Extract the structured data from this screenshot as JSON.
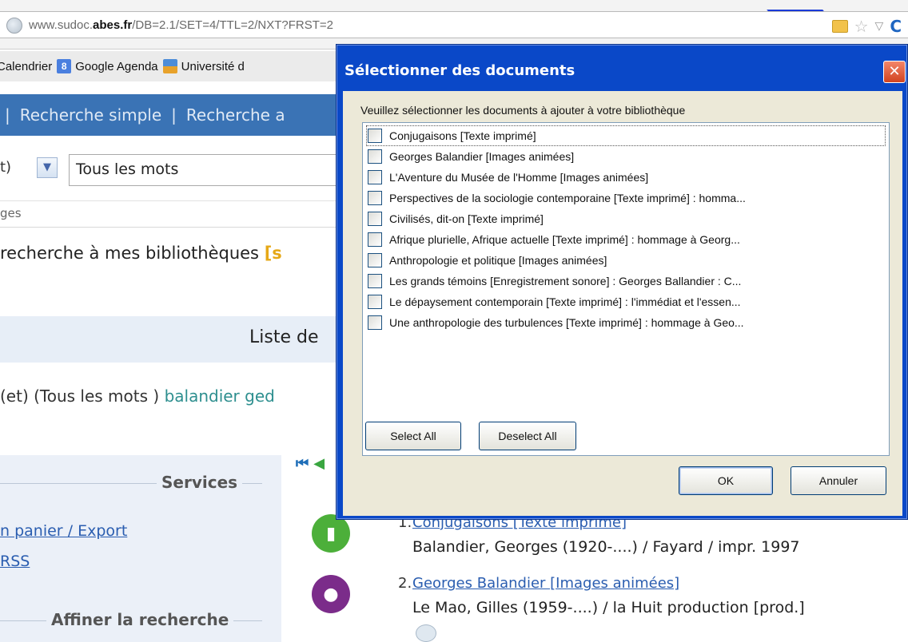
{
  "browser": {
    "url_prefix": "www.sudoc.",
    "url_domain": "abes.fr",
    "url_suffix": "/DB=2.1/SET=4/TTL=2/NXT?FRST=2",
    "bookmarks": [
      {
        "label": "Calendrier",
        "icon": "calendar-icon"
      },
      {
        "label": "Google Agenda",
        "icon": "google-icon"
      },
      {
        "label": "Université d",
        "icon": "university-icon"
      }
    ]
  },
  "page": {
    "nav_items": [
      "|",
      "Recherche simple",
      "|",
      "Recherche a"
    ],
    "select_tail": "t)",
    "search_mode": "Tous les mots",
    "ges_text": "ges",
    "ajout_text": "recherche à mes bibliothèques ",
    "ajout_bracket": "[s",
    "liste_title": "Liste de",
    "query_prefix": "(et) (Tous les mots ) ",
    "query_highlight": "balandier ged",
    "services_title": "Services",
    "panier_link": "n panier / Export",
    "rss_link": "RSS",
    "affiner_title": "Affiner la recherche",
    "results": [
      {
        "num": "1.",
        "title": "Conjugaisons [Texte imprimé]",
        "meta": "Balandier, Georges (1920-....) / Fayard / impr. 1997",
        "icon": "book-icon",
        "color": "#4caf3a"
      },
      {
        "num": "2.",
        "title": "Georges Balandier [Images animées]",
        "meta": "Le Mao, Gilles (1959-....) / la Huit production [prod.]",
        "icon": "video-icon",
        "color": "#7b2c8a"
      }
    ]
  },
  "dialog": {
    "title": "Sélectionner des documents",
    "prompt": "Veuillez sélectionner les documents à ajouter à votre bibliothèque",
    "items": [
      "Conjugaisons [Texte imprimé]",
      "Georges Balandier [Images animées]",
      "L'Aventure du Musée de l'Homme [Images animées]",
      "Perspectives de la sociologie contemporaine [Texte imprimé] : homma...",
      "Civilisés, dit-on [Texte imprimé]",
      "Afrique plurielle, Afrique actuelle [Texte imprimé] : hommage à Georg...",
      "Anthropologie et politique [Images animées]",
      "Les grands témoins [Enregistrement sonore] : Georges Ballandier : C...",
      "Le dépaysement contemporain [Texte imprimé] : l'immédiat et l'essen...",
      "Une anthropologie des turbulences [Texte imprimé] : hommage à Geo..."
    ],
    "select_all": "Select All",
    "deselect_all": "Deselect All",
    "ok": "OK",
    "cancel": "Annuler"
  }
}
